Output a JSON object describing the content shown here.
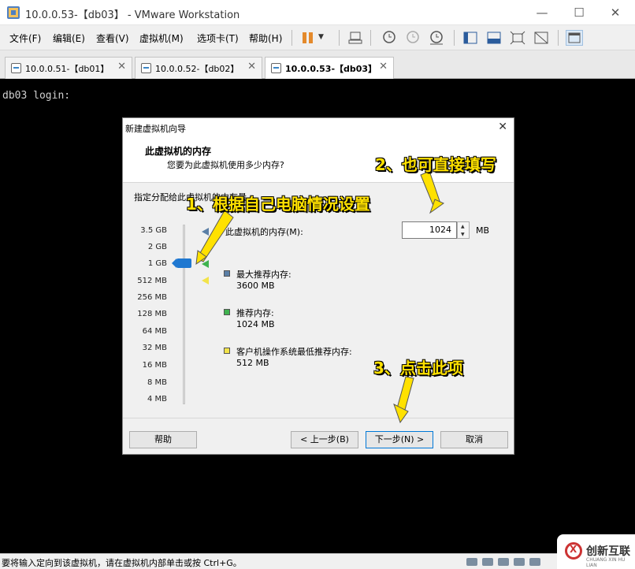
{
  "window": {
    "title": "10.0.0.53-【db03】 - VMware Workstation",
    "minimize": "—",
    "maximize": "☐",
    "close": "✕"
  },
  "menu": [
    "文件(F)",
    "编辑(E)",
    "查看(V)",
    "虚拟机(M)",
    "选项卡(T)",
    "帮助(H)"
  ],
  "tabs": [
    {
      "label": "10.0.0.51-【db01】",
      "close": "✕",
      "active": false
    },
    {
      "label": "10.0.0.52-【db02】",
      "close": "✕",
      "active": false
    },
    {
      "label": "10.0.0.53-【db03】",
      "close": "✕",
      "active": true
    }
  ],
  "console": {
    "text": "db03 login:"
  },
  "dialog": {
    "title": "新建虚拟机向导",
    "close": "✕",
    "header_title": "此虚拟机的内存",
    "header_subtitle": "您要为此虚拟机使用多少内存?",
    "instruction": "指定分配给此虚拟机的内存量。",
    "scale_labels": [
      "3.5 GB",
      "2 GB",
      "1 GB",
      "512 MB",
      "256 MB",
      "128 MB",
      "64 MB",
      "32 MB",
      "16 MB",
      "8 MB",
      "4 MB"
    ],
    "memory_label": "此虚拟机的内存(M):",
    "memory_value": "1024",
    "memory_unit": "MB",
    "max_recommended_label": "最大推荐内存:",
    "max_recommended_value": "3600 MB",
    "recommended_label": "推荐内存:",
    "recommended_value": "1024 MB",
    "guest_min_label": "客户机操作系统最低推荐内存:",
    "guest_min_value": "512 MB",
    "buttons": {
      "help": "帮助",
      "back": "< 上一步(B)",
      "next": "下一步(N) >",
      "cancel": "取消"
    }
  },
  "annotations": {
    "note1": "1、根据自己电脑情况设置",
    "note2": "2、也可直接填写",
    "note3": "3、点击此项"
  },
  "status": {
    "text": "要将输入定向到该虚拟机，请在虚拟机内部单击或按 Ctrl+G。"
  },
  "watermark": {
    "text": "创新互联",
    "sub": "CHUANG XIN HU LIAN"
  },
  "colors": {
    "accent": "#1f78d1",
    "annotation": "#ffe100",
    "max_marker": "#5b7fa6",
    "rec_marker": "#3fb34f",
    "min_marker": "#f2e34a"
  }
}
